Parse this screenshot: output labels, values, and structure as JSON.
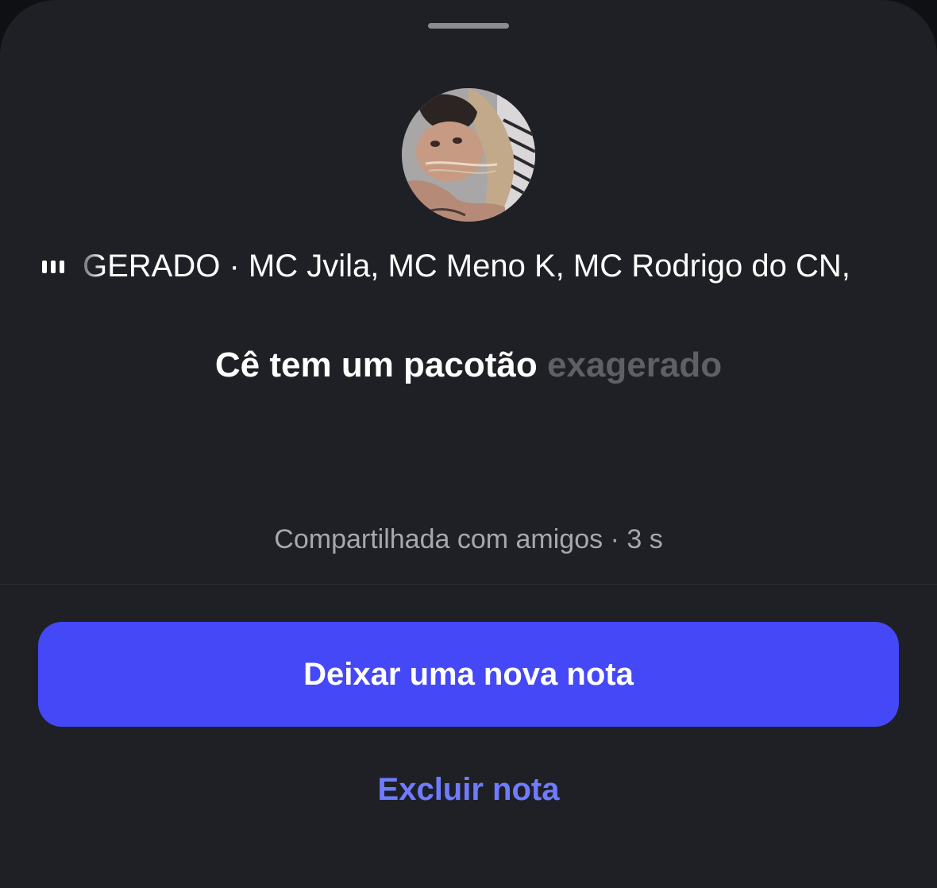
{
  "note": {
    "music": {
      "track": "GERADO",
      "separator": " · ",
      "artists": "MC Jvila, MC Meno K, MC Rodrigo do CN,"
    },
    "lyric": {
      "current": "Cê tem um pacotão",
      "upcoming": "exagerado"
    },
    "meta": "Compartilhada com amigos · 3 s"
  },
  "actions": {
    "new_note_label": "Deixar uma nova nota",
    "delete_label": "Excluir nota"
  },
  "colors": {
    "sheet_background": "#1f2025",
    "primary_button": "#4548f6",
    "link": "#6f7cff",
    "secondary_text": "#a6a8ad"
  }
}
